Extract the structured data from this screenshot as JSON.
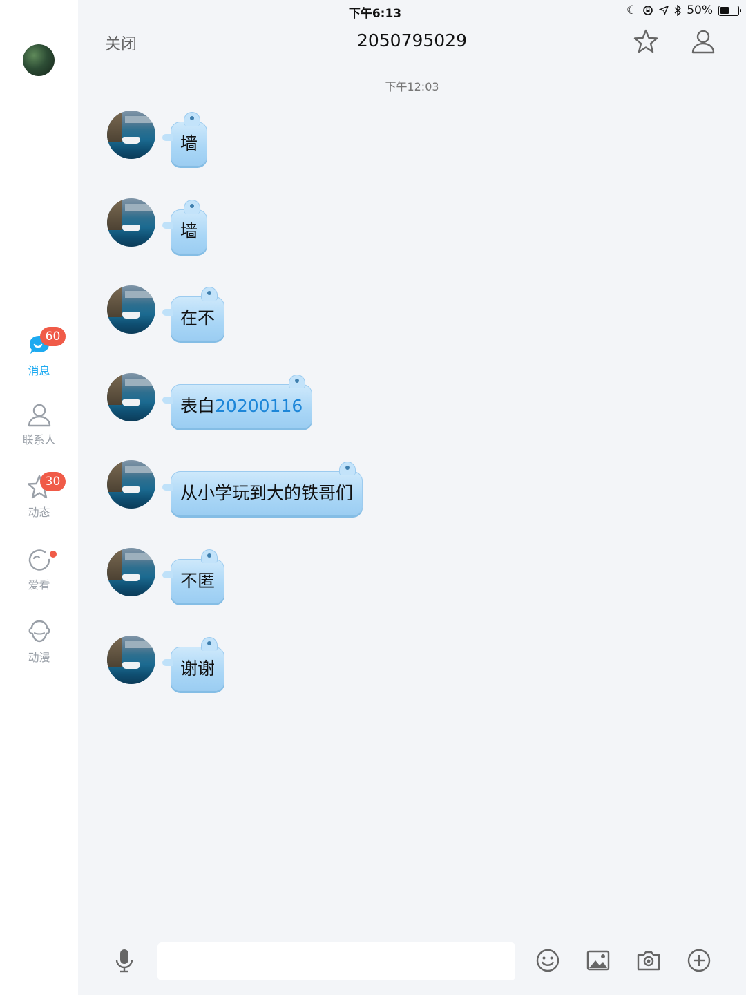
{
  "status_bar": {
    "device": "iPad",
    "time": "下午6:13",
    "battery": "50%",
    "battery_level": 0.5
  },
  "sidebar": {
    "items": [
      {
        "label": "消息",
        "badge": "60",
        "icon": "message-bubble-icon",
        "active": true
      },
      {
        "label": "联系人",
        "icon": "contacts-icon"
      },
      {
        "label": "动态",
        "badge": "30",
        "icon": "star-icon"
      },
      {
        "label": "爱看",
        "icon": "watch-icon",
        "dot": true
      },
      {
        "label": "动漫",
        "icon": "anime-icon"
      }
    ]
  },
  "header": {
    "close_label": "关闭",
    "title": "2050795029"
  },
  "chat": {
    "timestamp": "下午12:03",
    "messages": [
      {
        "text": "墙"
      },
      {
        "text": "墙"
      },
      {
        "text": "在不"
      },
      {
        "text_prefix": "表白",
        "text_number": "20200116"
      },
      {
        "text": "从小学玩到大的铁哥们"
      },
      {
        "text": "不匿"
      },
      {
        "text": "谢谢"
      }
    ]
  },
  "input": {
    "placeholder": ""
  },
  "colors": {
    "accent": "#1eaaf0",
    "badge": "#f05b48",
    "bubble": "#a9d6f6",
    "link": "#1d86d8"
  }
}
